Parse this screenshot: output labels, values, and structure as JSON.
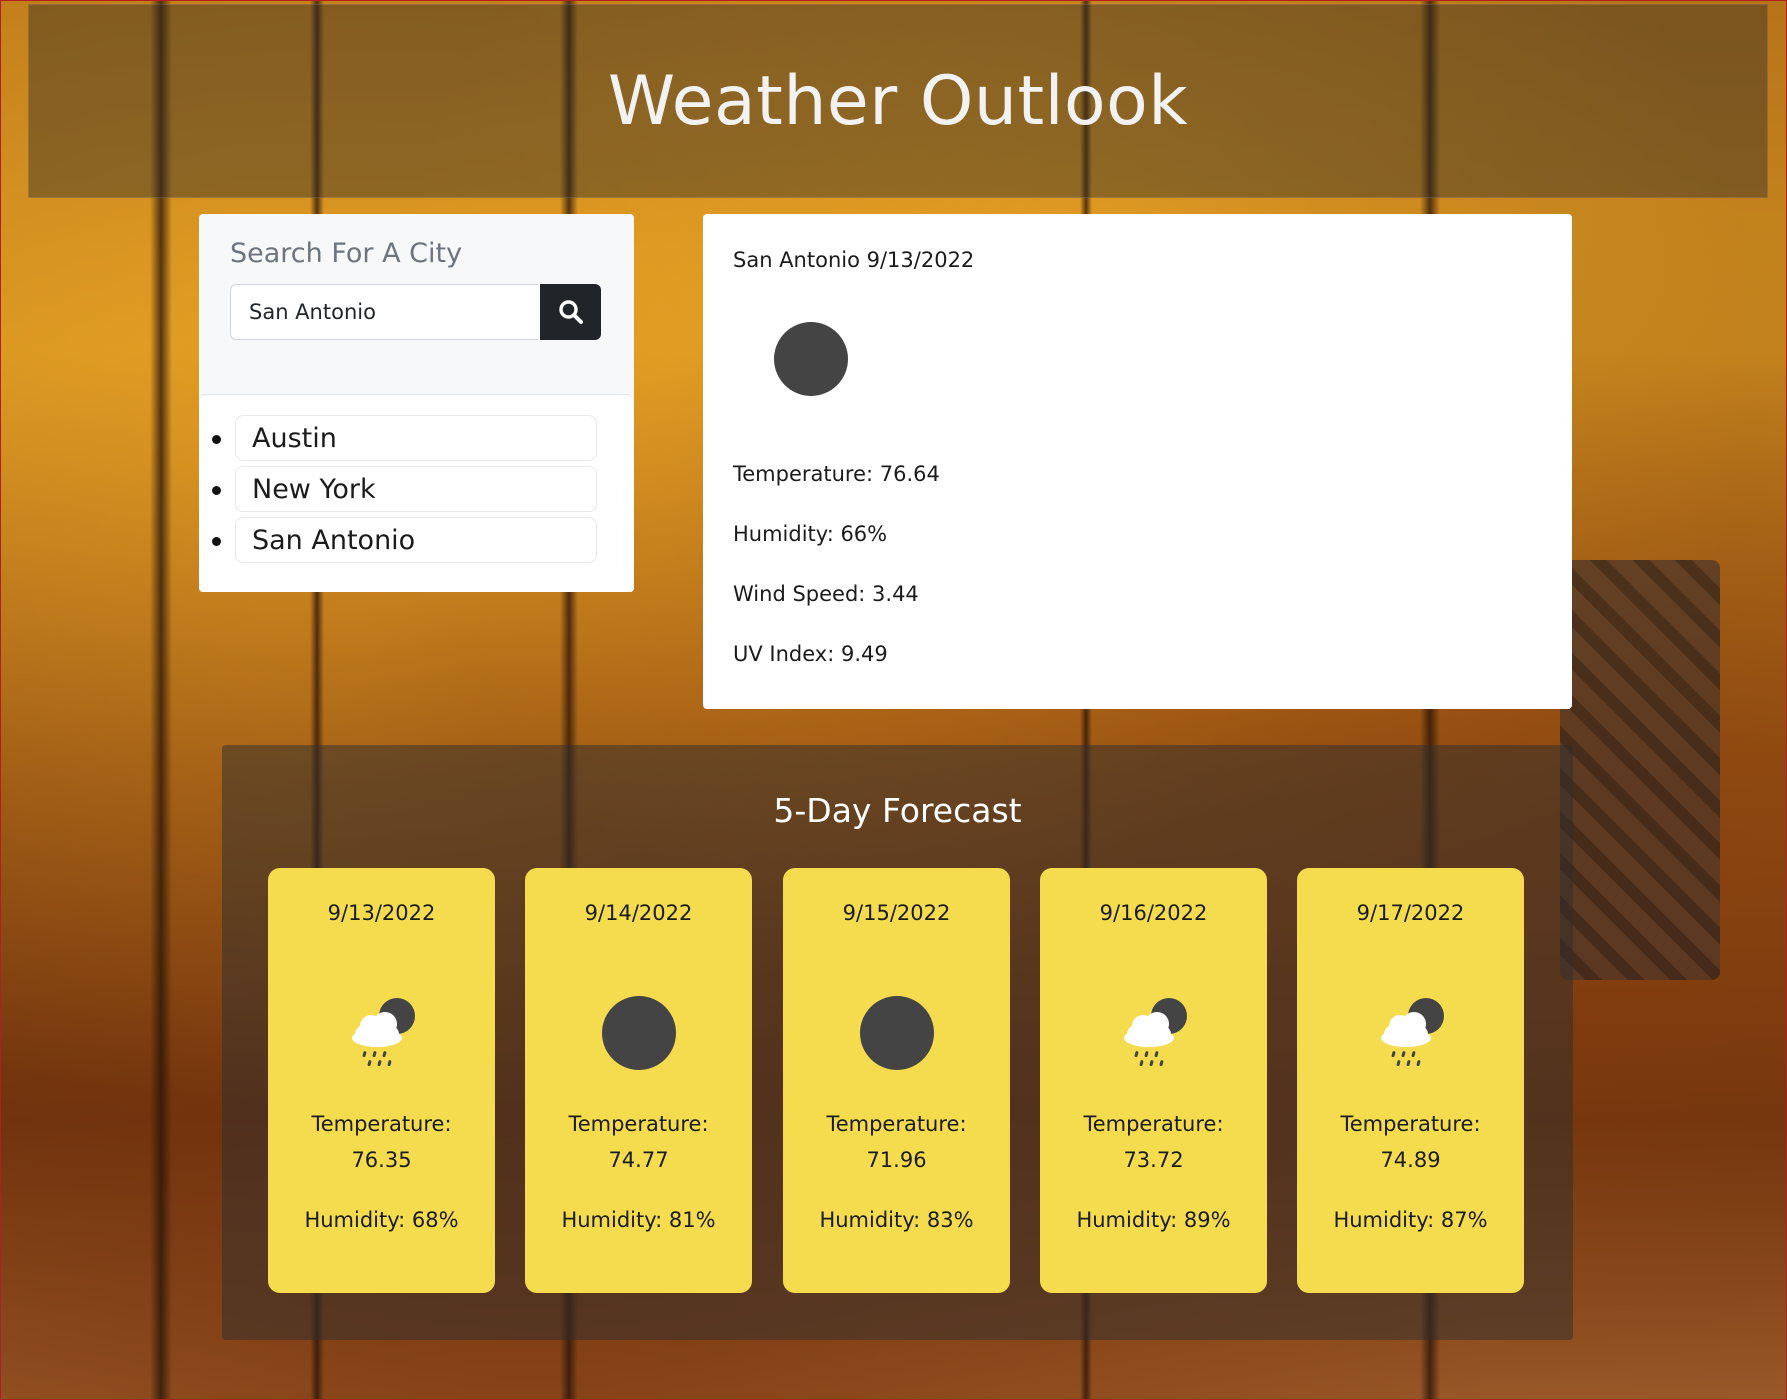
{
  "header": {
    "title": "Weather Outlook"
  },
  "search": {
    "title": "Search For A City",
    "input_value": "San Antonio",
    "button_icon": "search-icon"
  },
  "history": {
    "items": [
      "Austin",
      "New York",
      "San Antonio"
    ]
  },
  "current": {
    "title": "San Antonio 9/13/2022",
    "icon": "dark-circle-icon",
    "temperature": "Temperature: 76.64",
    "humidity": "Humidity: 66%",
    "wind": "Wind Speed: 3.44",
    "uv": "UV Index: 9.49"
  },
  "forecast": {
    "title": "5-Day Forecast",
    "days": [
      {
        "date": "9/13/2022",
        "icon": "rain-cloud-moon-icon",
        "temp_label": "Temperature:",
        "temp_value": "76.35",
        "humidity": "Humidity: 68%"
      },
      {
        "date": "9/14/2022",
        "icon": "dark-circle-icon",
        "temp_label": "Temperature:",
        "temp_value": "74.77",
        "humidity": "Humidity: 81%"
      },
      {
        "date": "9/15/2022",
        "icon": "dark-circle-icon",
        "temp_label": "Temperature:",
        "temp_value": "71.96",
        "humidity": "Humidity: 83%"
      },
      {
        "date": "9/16/2022",
        "icon": "rain-cloud-moon-icon",
        "temp_label": "Temperature:",
        "temp_value": "73.72",
        "humidity": "Humidity: 89%"
      },
      {
        "date": "9/17/2022",
        "icon": "rain-cloud-moon-icon",
        "temp_label": "Temperature:",
        "temp_value": "74.89",
        "humidity": "Humidity: 87%"
      }
    ]
  },
  "colors": {
    "card_yellow": "#f4dc4e",
    "button_dark": "#212529",
    "icon_dark": "#444444"
  }
}
